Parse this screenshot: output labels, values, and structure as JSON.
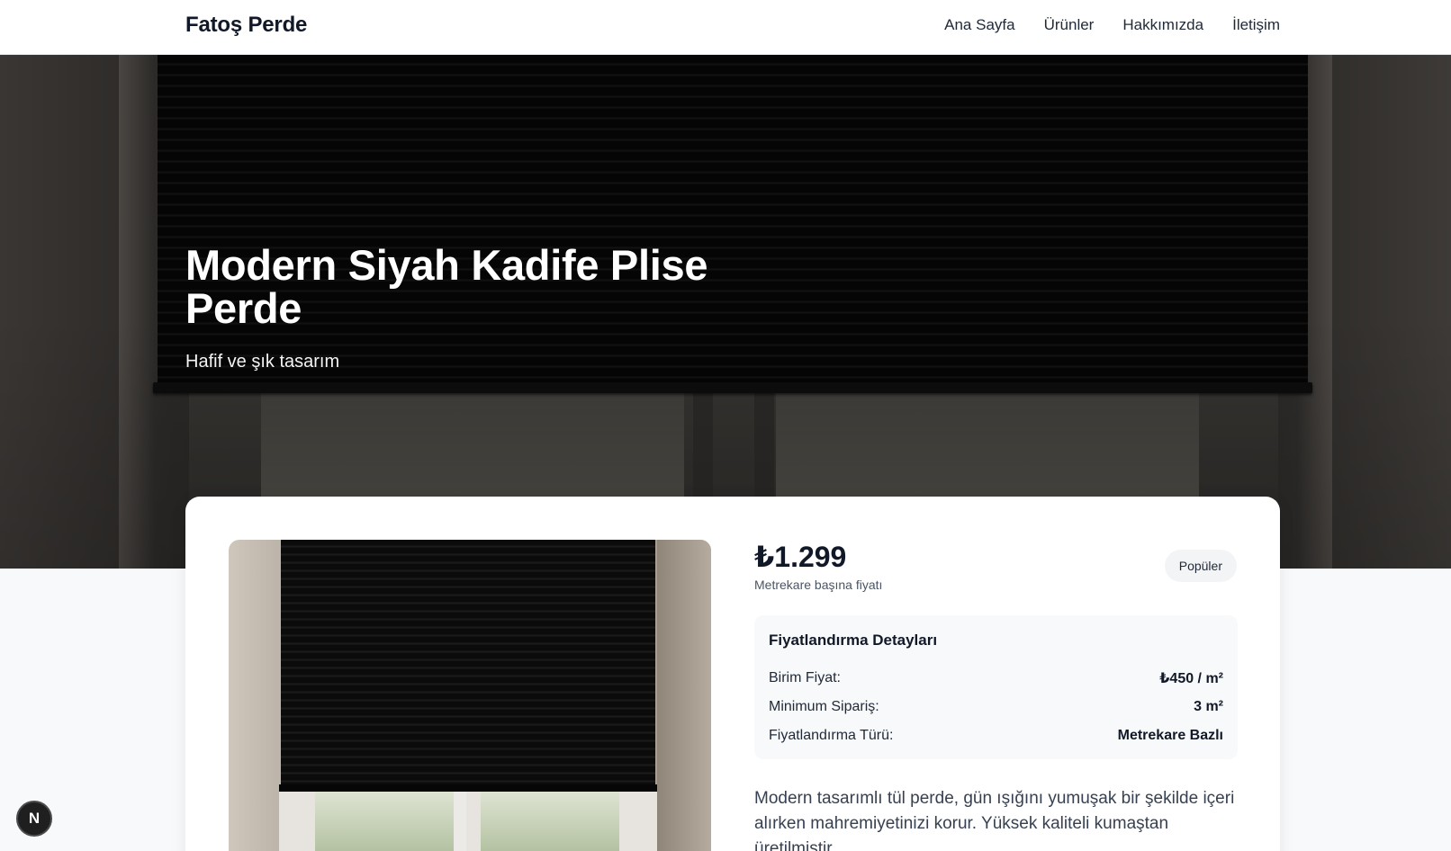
{
  "header": {
    "brand": "Fatoş Perde",
    "nav": [
      "Ana Sayfa",
      "Ürünler",
      "Hakkımızda",
      "İletişim"
    ]
  },
  "hero": {
    "title": "Modern Siyah Kadife Plise Perde",
    "subtitle": "Hafif ve şık tasarım"
  },
  "product": {
    "price": "₺1.299",
    "price_note": "Metrekare başına fiyatı",
    "badge": "Popüler",
    "details": {
      "title": "Fiyatlandırma Detayları",
      "rows": [
        {
          "label": "Birim Fiyat:",
          "value": "₺450 / m²"
        },
        {
          "label": "Minimum Sipariş:",
          "value": "3 m²"
        },
        {
          "label": "Fiyatlandırma Türü:",
          "value": "Metrekare Bazlı"
        }
      ]
    },
    "description": "Modern tasarımlı tül perde, gün ışığını yumuşak bir şekilde içeri alırken mahremiyetinizi korur. Yüksek kaliteli kumaştan üretilmiştir."
  },
  "floating_button": {
    "label": "N"
  },
  "colors": {
    "header_bg": "#ffffff",
    "page_bg": "#f8f9fb",
    "badge_bg": "#f3f4f6",
    "text": "#111827"
  }
}
